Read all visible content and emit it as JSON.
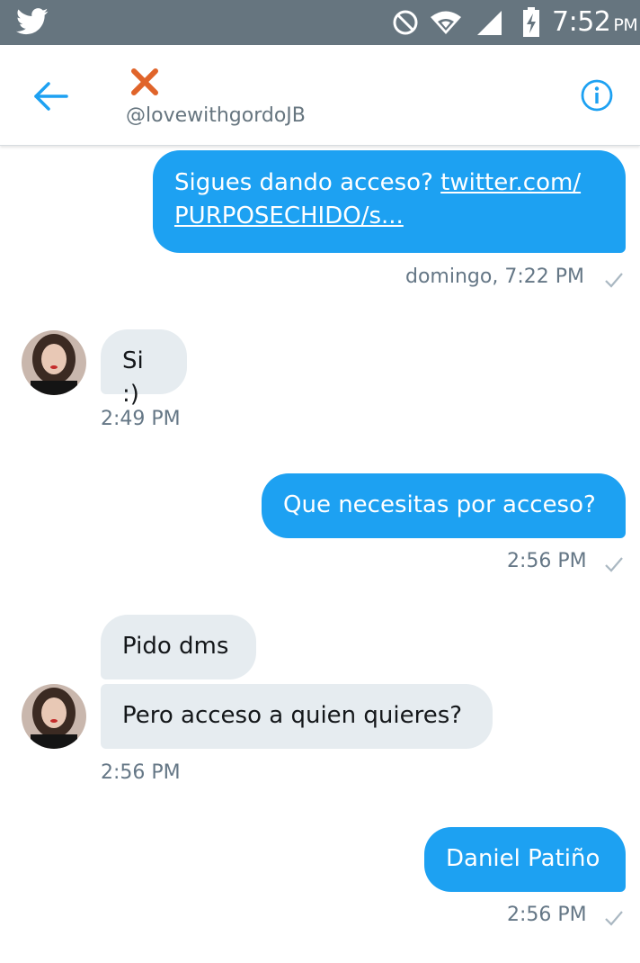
{
  "status_bar": {
    "time": "7:52",
    "ampm": "PM",
    "icons": [
      "twitter-bird-icon",
      "do-not-disturb-icon",
      "wifi-icon",
      "signal-icon",
      "battery-charging-icon"
    ]
  },
  "header": {
    "handle": "@lovewithgordoJB",
    "avatar_icon": "orange-x-icon",
    "back_icon": "back-arrow-icon",
    "info_icon": "info-icon"
  },
  "colors": {
    "accent": "#1da1f2",
    "incoming_bubble": "#e6ecf0",
    "status_bar": "#66757f",
    "meta_text": "#657786",
    "avatar_x": "#e0642a"
  },
  "messages": [
    {
      "from": "me",
      "line1_text": "Sigues dando acceso? ",
      "line1_link": "twitter.com/",
      "line2_link": "PURPOSECHIDO/s...",
      "time": "domingo, 7:22 PM"
    },
    {
      "from": "them",
      "text": "Si :)",
      "time": "2:49 PM"
    },
    {
      "from": "me",
      "text": "Que necesitas por acceso?",
      "time": "2:56 PM"
    },
    {
      "from": "them",
      "text": "Pido dms"
    },
    {
      "from": "them",
      "text": "Pero acceso a quien quieres?",
      "time": "2:56 PM"
    },
    {
      "from": "me",
      "text": "Daniel Patiño",
      "time": "2:56 PM"
    }
  ]
}
